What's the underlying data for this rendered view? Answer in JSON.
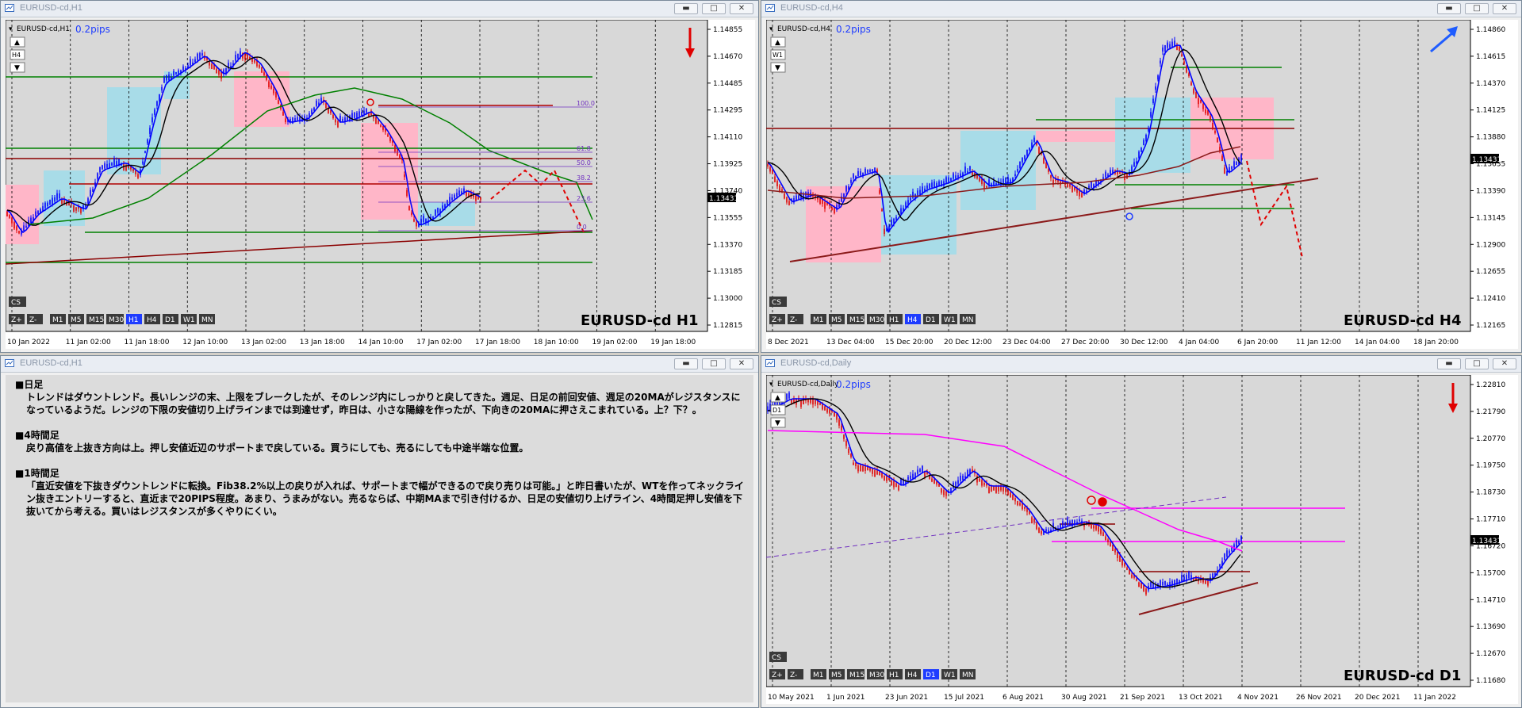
{
  "colors": {
    "bg": "#d8d8d8",
    "bull": "#0000ff",
    "bear": "#e00000",
    "ma_fast": "#0000ff",
    "ma_mid": "#000000",
    "ma_slow_h1": "#008000",
    "ma_slow_h4": "#8b1a1a",
    "ma_slow_d1": "#ff00ff",
    "support": "#008000",
    "resistance": "#8b0000",
    "zone_up": "#a8dce8",
    "zone_down": "#ffb6c8",
    "arrow_down": "#e00000",
    "arrow_up": "#1e5cff"
  },
  "windows": {
    "h1": {
      "title": "EURUSD-cd,H1",
      "symbol_label": "EURUSD-cd,H1",
      "spread": "0.2pips",
      "tf_label": "H4",
      "watermark": "EURUSD-cd H1",
      "current_price": "1.13431",
      "prices": [
        "1.14855",
        "1.14670",
        "1.14485",
        "1.14295",
        "1.14110",
        "1.13925",
        "1.13740",
        "1.13555",
        "1.13370",
        "1.13185",
        "1.13000",
        "1.12815"
      ],
      "dates": [
        "10 Jan 2022",
        "11 Jan 02:00",
        "11 Jan 18:00",
        "12 Jan 10:00",
        "13 Jan 02:00",
        "13 Jan 18:00",
        "14 Jan 10:00",
        "17 Jan 02:00",
        "17 Jan 18:00",
        "18 Jan 10:00",
        "19 Jan 02:00",
        "19 Jan 18:00"
      ],
      "fib": [
        "100.0",
        "61.8",
        "50.0",
        "38.2",
        "23.6",
        "0.0"
      ],
      "arrow": "down"
    },
    "h4": {
      "title": "EURUSD-cd,H4",
      "symbol_label": "EURUSD-cd,H4",
      "spread": "0.2pips",
      "tf_label": "W1",
      "watermark": "EURUSD-cd H4",
      "current_price": "1.13431",
      "prices": [
        "1.14860",
        "1.14615",
        "1.14370",
        "1.14125",
        "1.13880",
        "1.13635",
        "1.13390",
        "1.13145",
        "1.12900",
        "1.12655",
        "1.12410",
        "1.12165"
      ],
      "dates": [
        "8 Dec 2021",
        "13 Dec 04:00",
        "15 Dec 20:00",
        "20 Dec 12:00",
        "23 Dec 04:00",
        "27 Dec 20:00",
        "30 Dec 12:00",
        "4 Jan 04:00",
        "6 Jan 20:00",
        "11 Jan 12:00",
        "14 Jan 04:00",
        "18 Jan 20:00"
      ],
      "arrow": "up"
    },
    "d1": {
      "title": "EURUSD-cd,Daily",
      "symbol_label": "EURUSD-cd,Daily",
      "spread": "0.2pips",
      "tf_label": "D1",
      "watermark": "EURUSD-cd D1",
      "current_price": "1.13431",
      "prices": [
        "1.22810",
        "1.21790",
        "1.20770",
        "1.19750",
        "1.18730",
        "1.17710",
        "1.16720",
        "1.15700",
        "1.14710",
        "1.13690",
        "1.12670",
        "1.11680"
      ],
      "dates": [
        "10 May 2021",
        "1 Jun 2021",
        "23 Jun 2021",
        "15 Jul 2021",
        "6 Aug 2021",
        "30 Aug 2021",
        "21 Sep 2021",
        "13 Oct 2021",
        "4 Nov 2021",
        "26 Nov 2021",
        "20 Dec 2021",
        "11 Jan 2022"
      ],
      "arrow": "down"
    },
    "notes": {
      "title": "EURUSD-cd,H1",
      "sections": [
        {
          "heading": "■日足",
          "body": "トレンドはダウントレンド。長いレンジの末、上限をブレークしたが、そのレンジ内にしっかりと戻してきた。週足、日足の前回安値、週足の20MAがレジスタンスになっているようだ。レンジの下限の安値切り上げラインまでは到達せず，昨日は、小さな陽線を作ったが、下向きの20MAに押さえこまれている。上？下？。"
        },
        {
          "heading": "■4時間足",
          "body": "戻り高値を上抜き方向は上。押し安値近辺のサポートまで戻している。買うにしても、売るにしても中途半端な位置。"
        },
        {
          "heading": "■1時間足",
          "body": "「直近安値を下抜きダウントレンドに転換。Fib38.2%以上の戻りが入れば、サポートまで幅ができるので戻り売りは可能。」と昨日書いたが、WTを作ってネックライン抜きエントリーすると、直近まで20PIPS程度。あまり、うまみがない。売るならば、中期MAまで引き付けるか、日足の安値切り上げライン、4時間足押し安値を下抜いてから考える。買いはレジスタンスが多くやりにくい。"
        }
      ]
    }
  },
  "toolbar": {
    "cs": "CS",
    "zin": "Z+",
    "zout": "Z-",
    "tfs": [
      "M1",
      "M5",
      "M15",
      "M30",
      "H1",
      "H4",
      "D1",
      "W1",
      "MN"
    ]
  }
}
